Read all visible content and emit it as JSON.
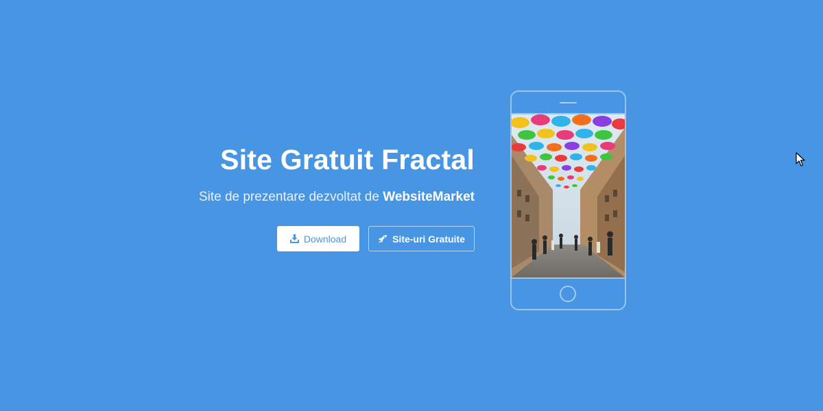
{
  "hero": {
    "title": "Site Gratuit Fractal",
    "subtitle_prefix": "Site de prezentare dezvoltat de ",
    "subtitle_brand": "WebsiteMarket",
    "buttons": [
      {
        "label": "Download",
        "icon": "download-icon"
      },
      {
        "label": "Site-uri Gratuite",
        "icon": "rocket-icon"
      }
    ]
  },
  "phone": {
    "screen_image": "street-with-colorful-umbrellas-photo"
  },
  "colors": {
    "background": "#4895e4",
    "text": "#ffffff",
    "button_primary_bg": "#ffffff",
    "button_primary_text": "#4895e4"
  }
}
